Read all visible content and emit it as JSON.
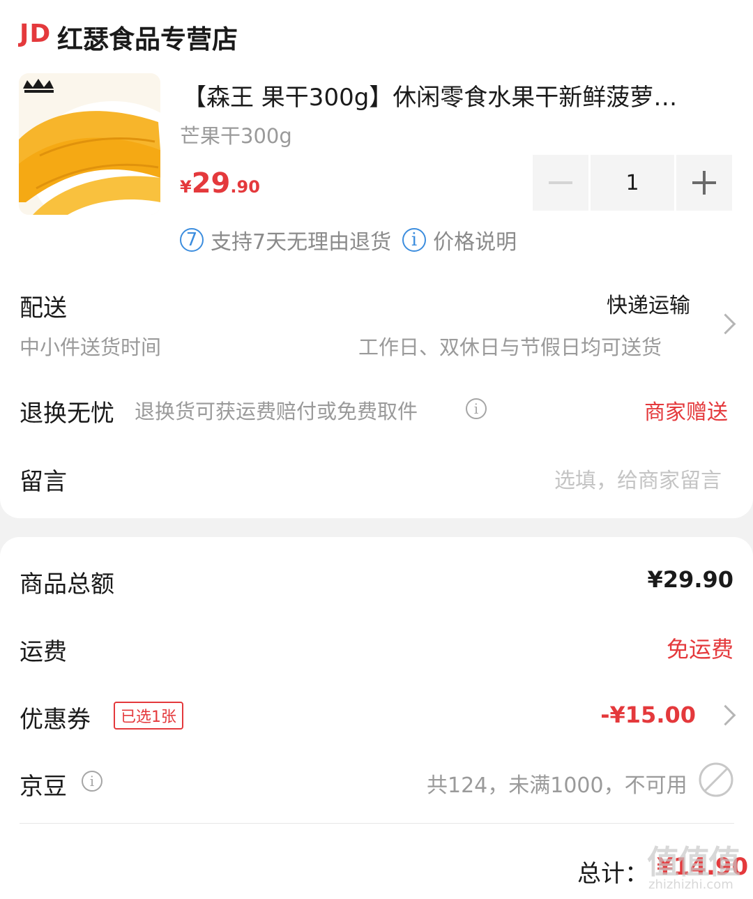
{
  "shop": {
    "logo": "JD",
    "name": "红瑟食品专营店"
  },
  "product": {
    "title": "【森王 果干300g】休闲零食水果干新鲜菠萝…",
    "spec": "芒果干300g",
    "price_currency": "¥",
    "price_int": "29",
    "price_dec": ".90",
    "quantity": "1"
  },
  "badges": {
    "return_icon_text": "7",
    "return_text": "支持7天无理由退货",
    "price_icon_text": "i",
    "price_text": "价格说明"
  },
  "delivery": {
    "label": "配送",
    "method": "快递运输",
    "sub_label": "中小件送货时间",
    "sub_value": "工作日、双休日与节假日均可送货"
  },
  "return_worry": {
    "label": "退换无忧",
    "desc": "退换货可获运费赔付或免费取件",
    "value": "商家赠送"
  },
  "message": {
    "label": "留言",
    "placeholder": "选填，给商家留言"
  },
  "summary": {
    "goods_total_label": "商品总额",
    "goods_total_value": "¥29.90",
    "shipping_label": "运费",
    "shipping_value": "免运费",
    "coupon_label": "优惠券",
    "coupon_tag": "已选1张",
    "coupon_value": "-¥15.00",
    "jingdou_label": "京豆",
    "jingdou_value": "共124，未满1000，不可用",
    "total_label": "总计：",
    "total_value": "¥14.90"
  },
  "watermark": {
    "big": "值值值",
    "small": "zhizhizhi.com"
  },
  "colors": {
    "accent": "#e4393c",
    "info_blue": "#3c8dde",
    "bg": "#f2f2f2"
  }
}
